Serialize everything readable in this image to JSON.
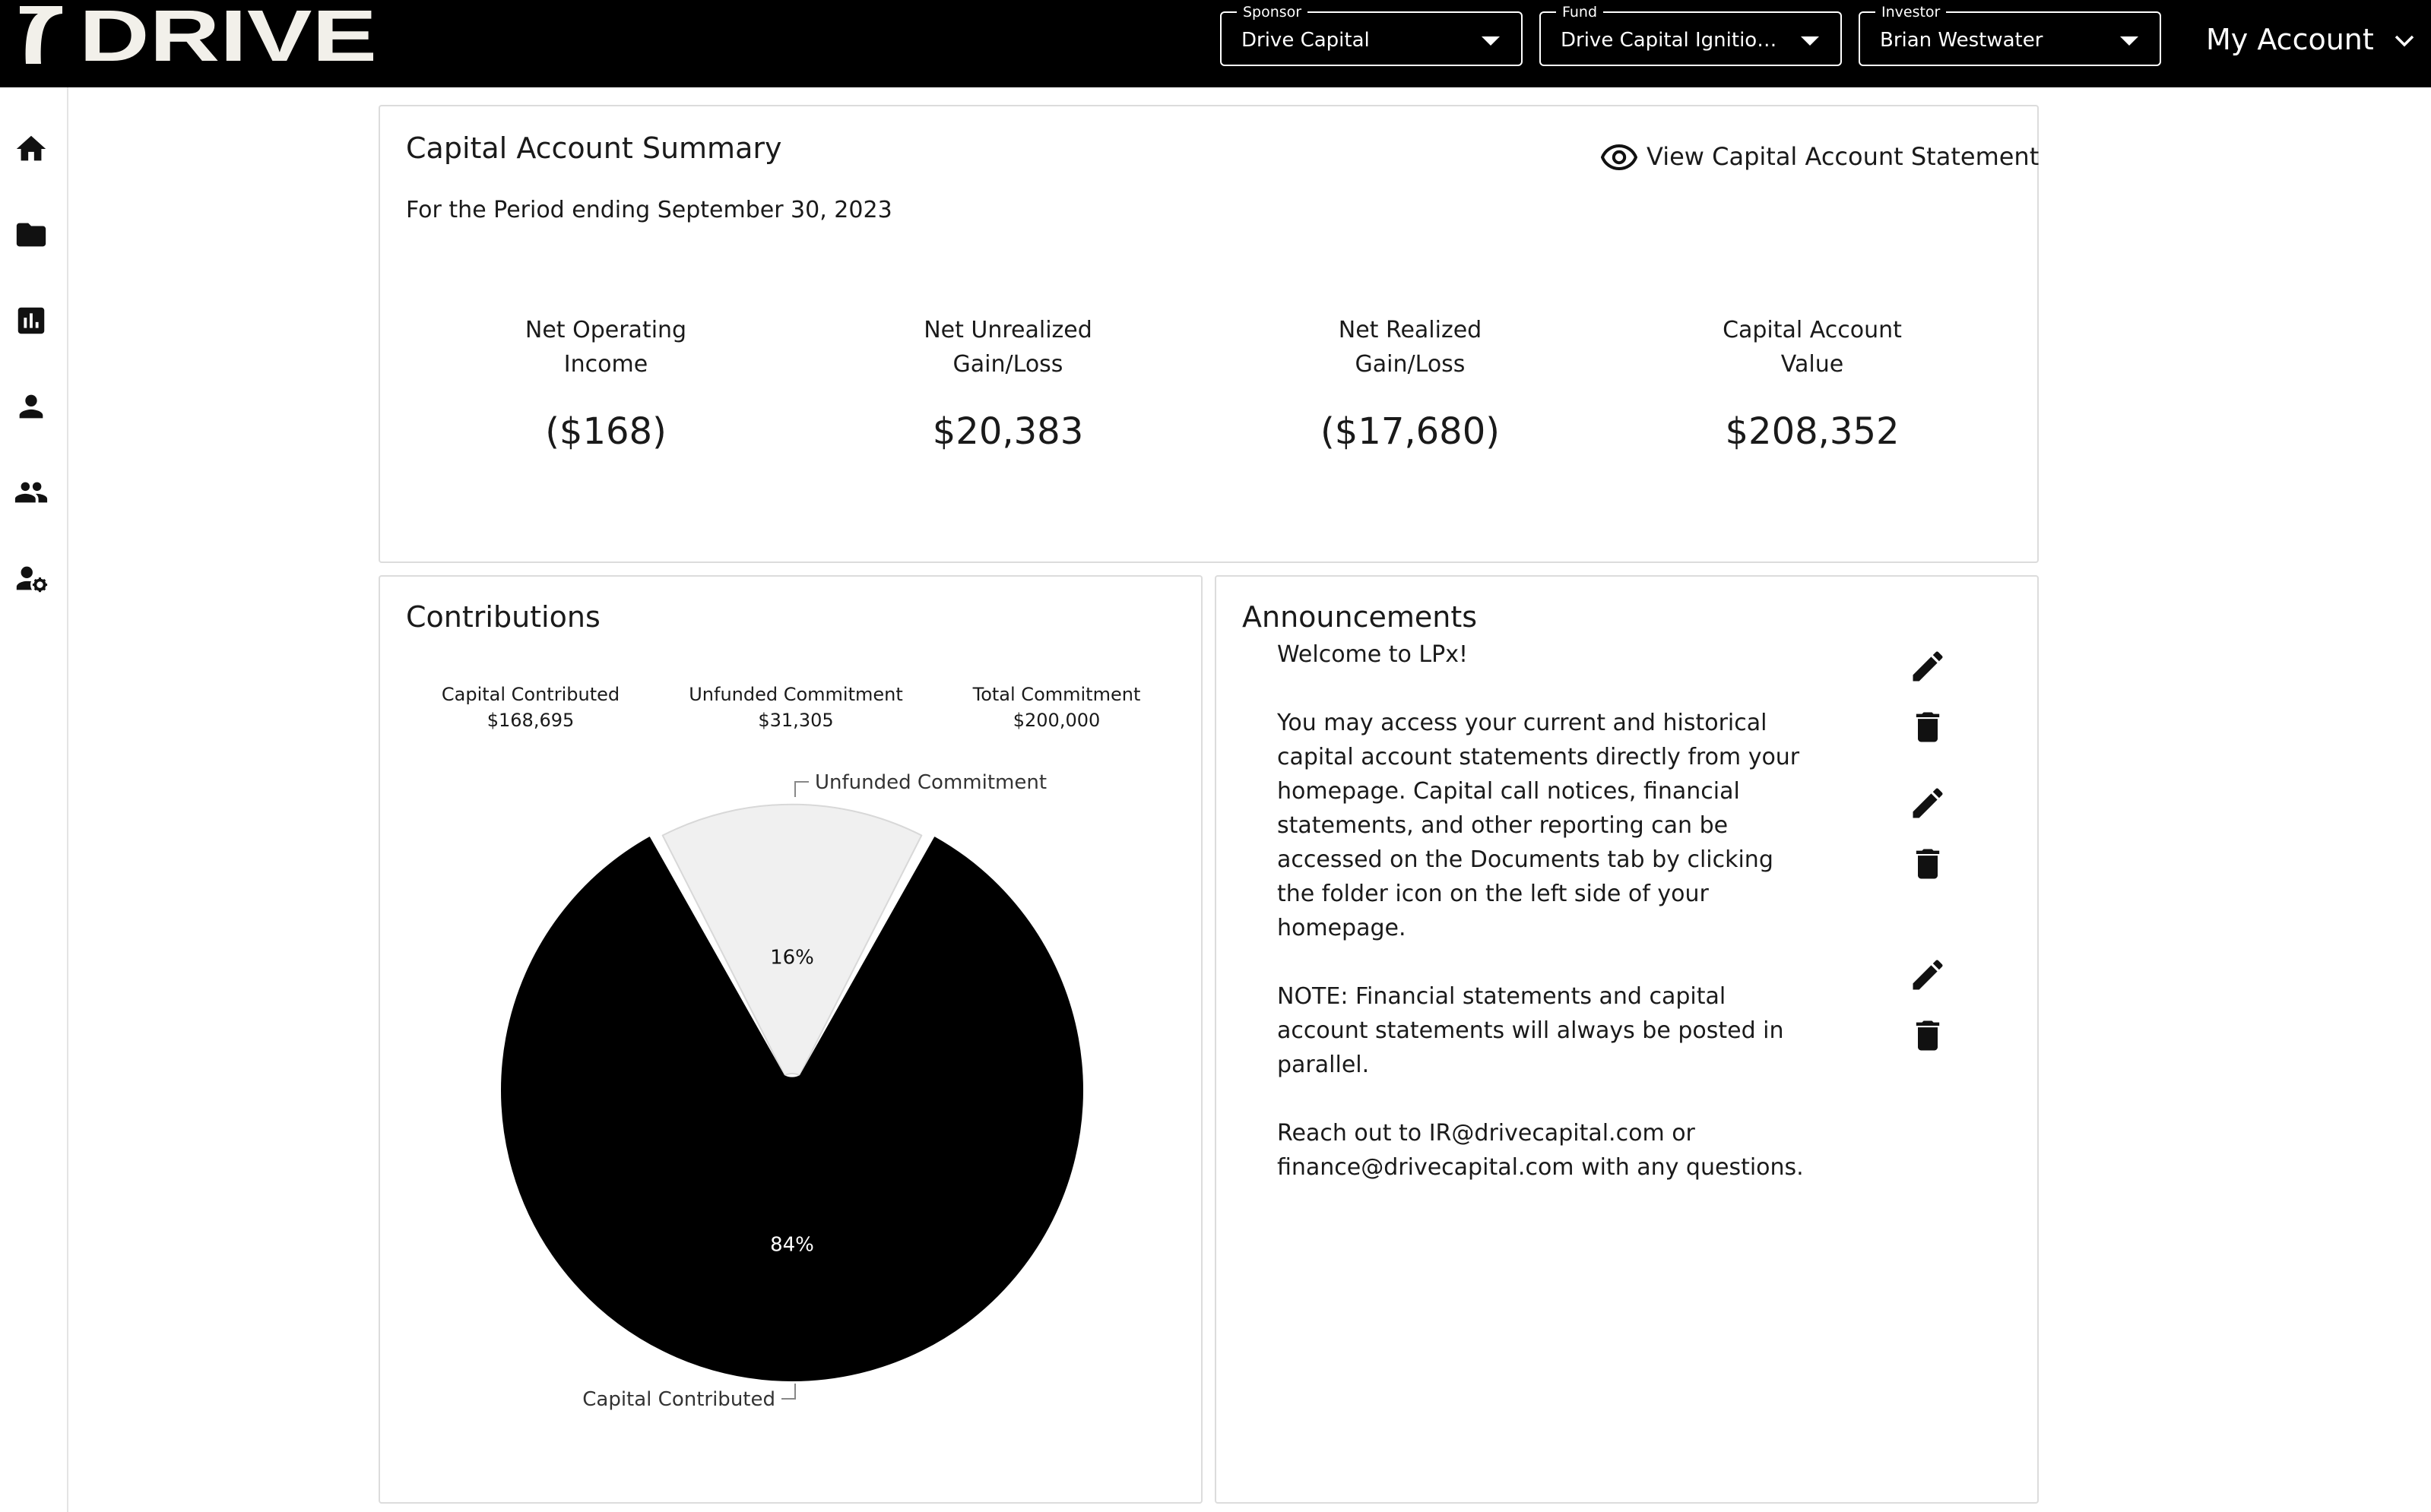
{
  "header": {
    "logo_text": "DRIVE",
    "sponsor": {
      "label": "Sponsor",
      "value": "Drive Capital"
    },
    "fund": {
      "label": "Fund",
      "value": "Drive Capital Ignition Fu..."
    },
    "investor": {
      "label": "Investor",
      "value": "Brian Westwater"
    },
    "account_menu": "My Account"
  },
  "sidebar": {
    "items": [
      {
        "icon": "home-icon"
      },
      {
        "icon": "folder-icon"
      },
      {
        "icon": "bar-chart-icon"
      },
      {
        "icon": "person-icon"
      },
      {
        "icon": "people-icon"
      },
      {
        "icon": "person-settings-icon"
      }
    ]
  },
  "summary": {
    "title": "Capital Account Summary",
    "period": "For the Period ending September 30, 2023",
    "view_statement": "View Capital Account Statement",
    "metrics": [
      {
        "label": "Net Operating\nIncome",
        "value": "($168)"
      },
      {
        "label": "Net Unrealized\nGain/Loss",
        "value": "$20,383"
      },
      {
        "label": "Net Realized\nGain/Loss",
        "value": "($17,680)"
      },
      {
        "label": "Capital Account\nValue",
        "value": "$208,352"
      }
    ]
  },
  "contributions": {
    "title": "Contributions",
    "stats": [
      {
        "label": "Capital Contributed",
        "value": "$168,695"
      },
      {
        "label": "Unfunded Commitment",
        "value": "$31,305"
      },
      {
        "label": "Total Commitment",
        "value": "$200,000"
      }
    ]
  },
  "chart_data": {
    "type": "pie",
    "categories": [
      "Capital Contributed",
      "Unfunded Commitment"
    ],
    "values": [
      168695,
      31305
    ],
    "percent_labels": [
      "84%",
      "16%"
    ],
    "colors": [
      "#000000",
      "#f0f0f0"
    ]
  },
  "announcements": {
    "title": "Announcements",
    "paragraphs": [
      "Welcome to LPx!",
      "You may access your current and historical capital account statements directly from your homepage. Capital call notices, financial statements, and other reporting can be accessed on the Documents tab by clicking the folder icon on the left side of your homepage.",
      "NOTE: Financial statements and capital account statements will always be posted in parallel.",
      "Reach out to IR@drivecapital.com or finance@drivecapital.com with any questions."
    ]
  }
}
